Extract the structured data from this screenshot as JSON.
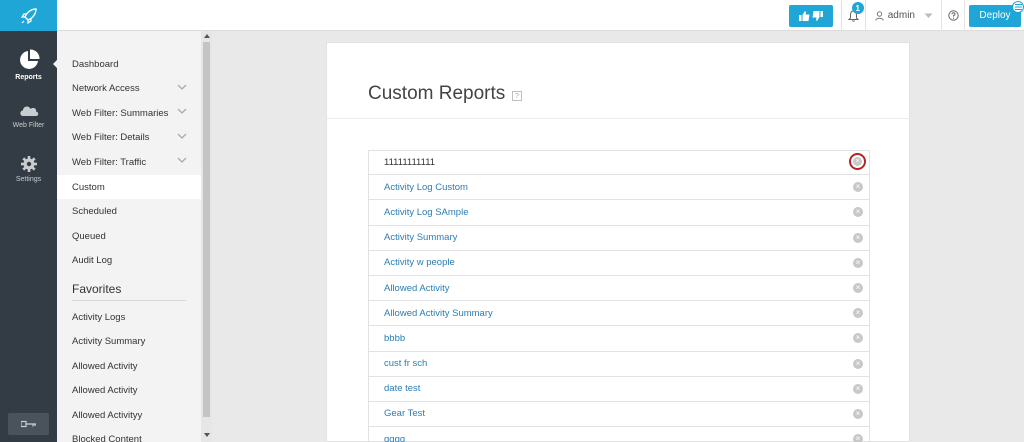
{
  "header": {
    "notification_count": "1",
    "user_name": "admin",
    "deploy_label": "Deploy"
  },
  "rail": {
    "items": [
      {
        "label": "Reports",
        "icon": "pie-chart-icon"
      },
      {
        "label": "Web Filter",
        "icon": "cloud-icon"
      },
      {
        "label": "Settings",
        "icon": "gear-icon"
      }
    ]
  },
  "sidebar": {
    "items": [
      {
        "label": "Dashboard"
      },
      {
        "label": "Network Access"
      },
      {
        "label": "Web Filter: Summaries"
      },
      {
        "label": "Web Filter: Details"
      },
      {
        "label": "Web Filter: Traffic"
      },
      {
        "label": "Custom"
      },
      {
        "label": "Scheduled"
      },
      {
        "label": "Queued"
      },
      {
        "label": "Audit Log"
      }
    ],
    "favorites_heading": "Favorites",
    "favorites": [
      {
        "label": "Activity Logs"
      },
      {
        "label": "Activity Summary"
      },
      {
        "label": "Allowed Activity"
      },
      {
        "label": "Allowed Activity"
      },
      {
        "label": "Allowed Activityy"
      },
      {
        "label": "Blocked Content"
      }
    ]
  },
  "main": {
    "title": "Custom Reports",
    "reports": [
      {
        "name": "11111111111"
      },
      {
        "name": "Activity Log Custom"
      },
      {
        "name": "Activity Log SAmple"
      },
      {
        "name": "Activity Summary"
      },
      {
        "name": "Activity w people"
      },
      {
        "name": "Allowed Activity"
      },
      {
        "name": "Allowed Activity Summary"
      },
      {
        "name": "bbbb"
      },
      {
        "name": "cust fr sch"
      },
      {
        "name": "date test"
      },
      {
        "name": "Gear Test"
      },
      {
        "name": "gggg"
      }
    ]
  },
  "colors": {
    "accent": "#1fa5d6",
    "rail_bg": "#333c44",
    "link": "#2a7db5",
    "highlight_ring": "#b72424"
  }
}
